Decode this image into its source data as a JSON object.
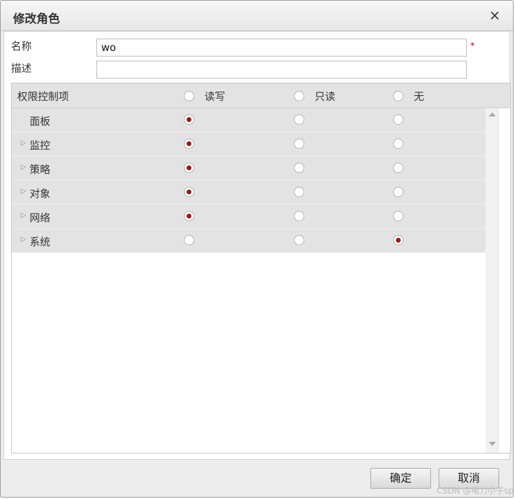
{
  "dialog": {
    "title": "修改角色",
    "close_glyph": "×"
  },
  "form": {
    "name_label": "名称",
    "name_value": "wo",
    "required_mark": "*",
    "desc_label": "描述",
    "desc_value": ""
  },
  "permissions": {
    "header": {
      "title": "权限控制项",
      "options": [
        "读写",
        "只读",
        "无"
      ]
    },
    "rows": [
      {
        "label": "面板",
        "expandable": false,
        "selected": 0
      },
      {
        "label": "监控",
        "expandable": true,
        "selected": 0
      },
      {
        "label": "策略",
        "expandable": true,
        "selected": 0
      },
      {
        "label": "对象",
        "expandable": true,
        "selected": 0
      },
      {
        "label": "网络",
        "expandable": true,
        "selected": 0
      },
      {
        "label": "系统",
        "expandable": true,
        "selected": 2
      }
    ]
  },
  "footer": {
    "confirm_label": "确定",
    "cancel_label": "取消"
  },
  "watermark": "CSDN @电力小子sp",
  "colors": {
    "radio_checked": "#a01414",
    "required": "#dd0000"
  },
  "icons": {
    "expand": "triangle-right-icon",
    "close": "close-icon"
  }
}
